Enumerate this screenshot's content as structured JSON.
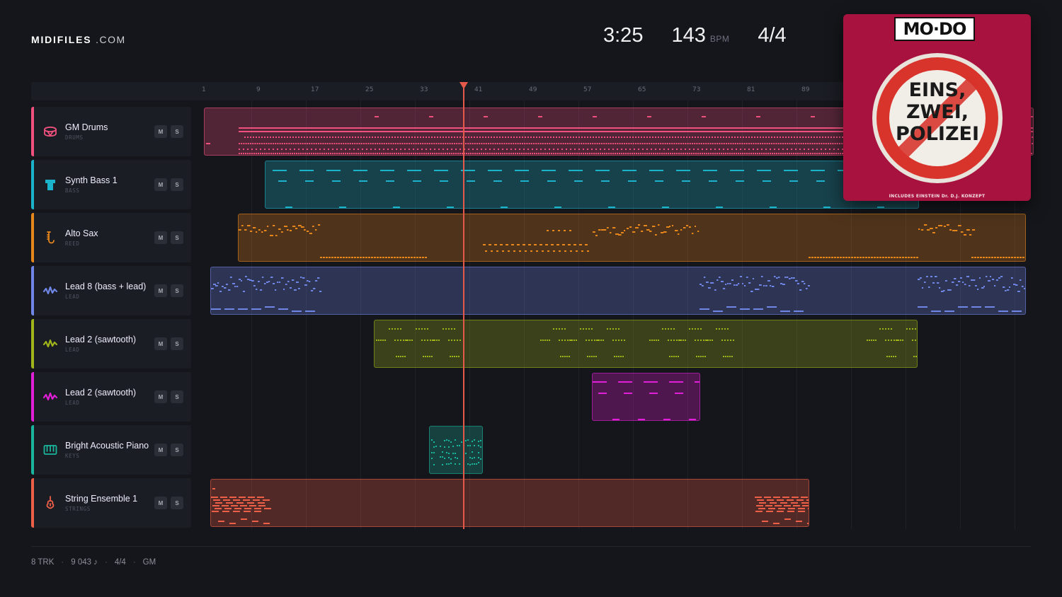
{
  "brand": {
    "bold": "MIDIFILES",
    "domain": ".COM"
  },
  "transport": {
    "time": "3:25",
    "tempo": "143",
    "tempo_unit": "BPM",
    "meter": "4/4"
  },
  "ruler_ticks": [
    "1",
    "9",
    "17",
    "25",
    "33",
    "41",
    "49",
    "57",
    "65",
    "73",
    "81",
    "89"
  ],
  "tracks": [
    {
      "name": "GM Drums",
      "sub": "DRUMS",
      "icon": "drum-icon",
      "color": "#f0507e",
      "mute": "M",
      "solo": "S"
    },
    {
      "name": "Synth Bass 1",
      "sub": "BASS",
      "icon": "bass-icon",
      "color": "#1bb3c9",
      "mute": "M",
      "solo": "S"
    },
    {
      "name": "Alto Sax",
      "sub": "REED",
      "icon": "sax-icon",
      "color": "#e7861b",
      "mute": "M",
      "solo": "S"
    },
    {
      "name": "Lead 8 (bass + lead)",
      "sub": "LEAD",
      "icon": "wave-icon",
      "color": "#6f86e6",
      "mute": "M",
      "solo": "S"
    },
    {
      "name": "Lead 2 (sawtooth)",
      "sub": "LEAD",
      "icon": "wave-icon",
      "color": "#9fb51a",
      "mute": "M",
      "solo": "S"
    },
    {
      "name": "Lead 2 (sawtooth)",
      "sub": "LEAD",
      "icon": "wave-icon",
      "color": "#e21fd8",
      "mute": "M",
      "solo": "S"
    },
    {
      "name": "Bright Acoustic Piano",
      "sub": "KEYS",
      "icon": "piano-icon",
      "color": "#1ab59d",
      "mute": "M",
      "solo": "S"
    },
    {
      "name": "String Ensemble 1",
      "sub": "STRINGS",
      "icon": "violin-icon",
      "color": "#ee5f48",
      "mute": "M",
      "solo": "S"
    }
  ],
  "footer": {
    "tracks": "8 TRK",
    "notes": "9 043 ♪",
    "meter": "4/4",
    "standard": "GM"
  },
  "cover": {
    "brand": "MO·DO",
    "line1": "EINS,",
    "line2": "ZWEI,",
    "line3": "POLIZEI",
    "fine": "INCLUDES EINSTEIN Dr. D.J. KONZEPT"
  }
}
